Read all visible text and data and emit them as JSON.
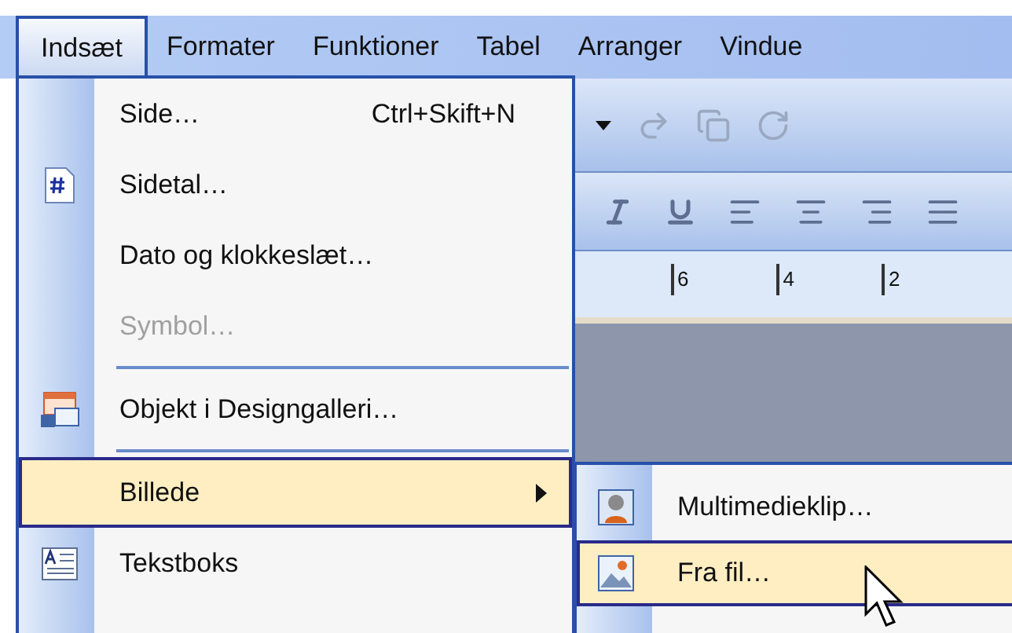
{
  "menubar": [
    {
      "label": "Indsæt",
      "selected": true
    },
    {
      "label": "Formater",
      "selected": false
    },
    {
      "label": "Funktioner",
      "selected": false
    },
    {
      "label": "Tabel",
      "selected": false
    },
    {
      "label": "Arranger",
      "selected": false
    },
    {
      "label": "Vindue",
      "selected": false
    }
  ],
  "menu": [
    {
      "kind": "item",
      "label": "Side…",
      "shortcut": "Ctrl+Skift+N",
      "disabled": false,
      "selected": false,
      "submenu": false
    },
    {
      "kind": "item",
      "label": "Sidetal…",
      "disabled": false,
      "selected": false,
      "submenu": false
    },
    {
      "kind": "item",
      "label": "Dato og klokkeslæt…",
      "disabled": false,
      "selected": false,
      "submenu": false
    },
    {
      "kind": "item",
      "label": "Symbol…",
      "disabled": true,
      "selected": false,
      "submenu": false
    },
    {
      "kind": "separator"
    },
    {
      "kind": "item",
      "label": "Objekt i Designgalleri…",
      "disabled": false,
      "selected": false,
      "submenu": false
    },
    {
      "kind": "separator"
    },
    {
      "kind": "item",
      "label": "Billede",
      "disabled": false,
      "selected": true,
      "submenu": true
    },
    {
      "kind": "item",
      "label": "Tekstboks",
      "disabled": false,
      "selected": false,
      "submenu": false
    }
  ],
  "submenu": [
    {
      "label": "Multimedieklip…",
      "selected": false
    },
    {
      "label": "Fra fil…",
      "selected": true
    }
  ],
  "ruler": [
    "6",
    "4",
    "2"
  ]
}
